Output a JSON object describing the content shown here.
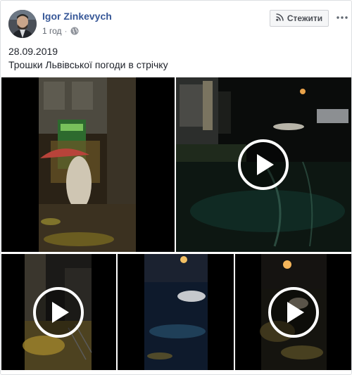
{
  "post": {
    "author": "Igor Zinkevych",
    "time": "1 год",
    "date_line": "28.09.2019",
    "caption": "Трошки Львівської погоди в стрічку"
  },
  "actions": {
    "follow_label": "Стежити"
  },
  "icons": {
    "follow": "rss-icon",
    "more": "more-options-icon",
    "audience": "globe-icon",
    "play": "play-icon"
  },
  "colors": {
    "author_link": "#385898",
    "meta_text": "#616770",
    "button_bg": "#f5f6f7",
    "button_border": "#ced0d4"
  }
}
